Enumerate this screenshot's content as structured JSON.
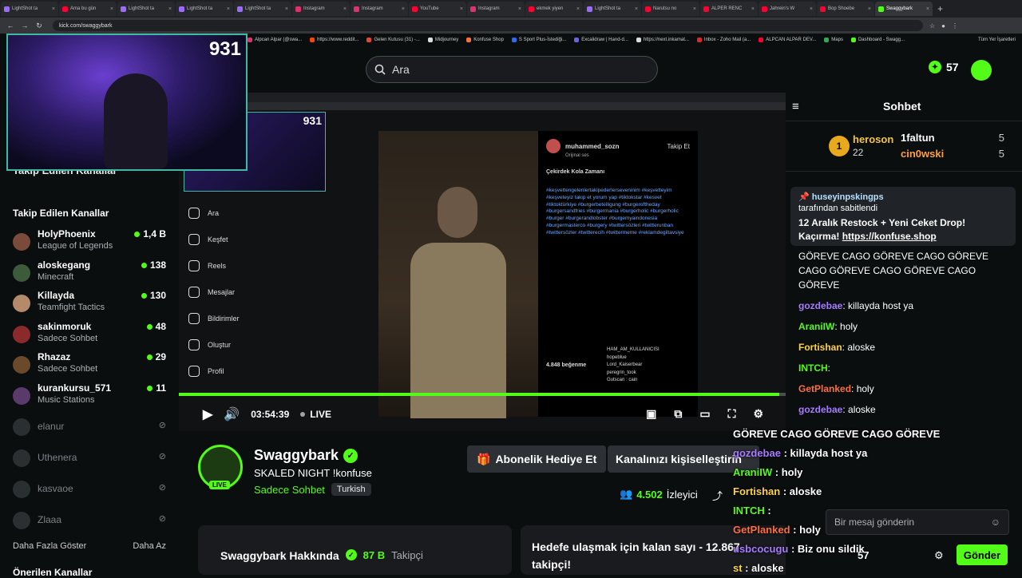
{
  "browser": {
    "tabs": [
      {
        "label": "LightShot ta",
        "color": "#9b6bff"
      },
      {
        "label": "Ama bu gün",
        "color": "#ff0033"
      },
      {
        "label": "LightShot ta",
        "color": "#9b6bff"
      },
      {
        "label": "LightShot ta",
        "color": "#9b6bff"
      },
      {
        "label": "LightShot ta",
        "color": "#9b6bff"
      },
      {
        "label": "Instagram",
        "color": "#e1306c"
      },
      {
        "label": "Instagram",
        "color": "#e1306c"
      },
      {
        "label": "YouTube",
        "color": "#ff0033"
      },
      {
        "label": "Instagram",
        "color": "#e1306c"
      },
      {
        "label": "ekmek yiyen",
        "color": "#ff0033"
      },
      {
        "label": "LightShot ta",
        "color": "#9b6bff"
      },
      {
        "label": "Narutsu no",
        "color": "#ff0033"
      },
      {
        "label": "ALPER RENC",
        "color": "#ff0033"
      },
      {
        "label": "Jahrein's W",
        "color": "#ff0033"
      },
      {
        "label": "Bop Shoebe",
        "color": "#ff0033"
      },
      {
        "label": "Swaggybark",
        "color": "#53fc18",
        "active": true
      }
    ],
    "url": "kick.com/swaggybark",
    "bookmarks": [
      {
        "label": "Alpcan Alpar (@swa...",
        "color": "#e1306c"
      },
      {
        "label": "https://www.reddit...",
        "color": "#ff4500"
      },
      {
        "label": "Gelen Kutusu (31) -...",
        "color": "#ea4335"
      },
      {
        "label": "Midjourney",
        "color": "#dddddd"
      },
      {
        "label": "Konfuse Shop",
        "color": "#ff6d3a"
      },
      {
        "label": "S Sport Plus-İstediği...",
        "color": "#2a6df4"
      },
      {
        "label": "Excalidraw | Hand-d...",
        "color": "#6965db"
      },
      {
        "label": "https://next.inkamat...",
        "color": "#dddddd"
      },
      {
        "label": "Inbox - Zoho Mail (a...",
        "color": "#e42527"
      },
      {
        "label": "ALPCAN ALPAR DEV...",
        "color": "#ff0033"
      },
      {
        "label": "Maps",
        "color": "#34a853"
      },
      {
        "label": "Dashboard - Swagg...",
        "color": "#53fc18"
      }
    ],
    "bookmarks_all": "Tüm Yer İşaretleri"
  },
  "header": {
    "search_placeholder": "Ara",
    "kicks_count": "57"
  },
  "webcam": {
    "viewer_count": "931"
  },
  "sidebar": {
    "ghost_title": "Takip Edilen Kanallar",
    "title": "Takip Edilen Kanallar",
    "channels": [
      {
        "name": "HolyPhoenix",
        "category": "League of Legends",
        "viewers": "1,4 B",
        "avatar": "#7a4a3a"
      },
      {
        "name": "aloskegang",
        "category": "Minecraft",
        "viewers": "138",
        "avatar": "#3d5a3a"
      },
      {
        "name": "Killayda",
        "category": "Teamfight Tactics",
        "viewers": "130",
        "avatar": "#b38a6a"
      },
      {
        "name": "sakinmoruk",
        "category": "Sadece Sohbet",
        "viewers": "48",
        "avatar": "#8a2a2a"
      },
      {
        "name": "Rhazaz",
        "category": "Sadece Sohbet",
        "viewers": "29",
        "avatar": "#6a4a2a"
      },
      {
        "name": "kurankursu_571",
        "category": "Music Stations",
        "viewers": "11",
        "avatar": "#5a3a6a"
      }
    ],
    "offline": [
      "elanur",
      "Uthenera",
      "kasvaoe",
      "Zlaaa"
    ],
    "show_more": "Daha Fazla Göster",
    "show_less": "Daha Az",
    "recommended": "Önerilen Kanallar"
  },
  "player": {
    "time": "03:54:39",
    "live": "LIVE",
    "progress": 0.99,
    "nested_count": "931",
    "ig_menu": [
      "Ara",
      "Keşfet",
      "Reels",
      "Mesajlar",
      "Bildirimler",
      "Oluştur",
      "Profil"
    ],
    "ig_user": "muhammed_sozn",
    "ig_sub": "Orijinal ses",
    "ig_caption": "Çekirdek Kola Zamanı",
    "ig_tags": "#keşvettengelenlertakipederlerseveninim #keşvetteyim #keşveteyiz takip et yorum yap #tiktokstar #kesvet #tiktoktürkiye #burgerbeteiligung #burgeroftheday #burgersandfries #burgermania #burgerholic #burgerholic #burger #burgerandlobster #burgemyaindonesia #burgermasterco #burgery #twittersözleri #twitterunban #twittersözler #twitterecih #twittermeme #reklamdegiltavsiye",
    "ig_likes": "4.848 beğenme",
    "ig_follow": "Takip Et",
    "overlay_lines": [
      "HAM_AM_KULLANICISI",
      "hopeblue",
      "Lord_Kaiserbear",
      "peregrin_took",
      "Gutscan : cain"
    ]
  },
  "channel": {
    "name": "Swaggybark",
    "title": "SKALED NIGHT !konfuse",
    "category": "Sadece Sohbet",
    "tag": "Turkish",
    "live_badge": "LIVE",
    "gift_label": "Abonelik Hediye Et",
    "customize_label": "Kanalınızı kişiselleştirin",
    "viewers": "4.502",
    "viewers_label": "İzleyici",
    "about_label": "Swaggybark Hakkında",
    "followers": "87 B",
    "followers_label": "Takipçi",
    "goal_text": "Hedefe ulaşmak için kalan sayı - 12.867 takipçi!"
  },
  "chat": {
    "title": "Sohbet",
    "leader": {
      "name": "heroson",
      "count": "22",
      "rank": "1"
    },
    "leaders": [
      {
        "name": "1faltun",
        "value": "5"
      },
      {
        "name": "cin0wski",
        "value": "5"
      }
    ],
    "pinned": {
      "by": "huseyinpskingps",
      "sub": "tarafından sabitlendi",
      "text": "12 Aralık Restock + Yeni Ceket Drop! Kaçırma!",
      "link": "https://konfuse.shop"
    },
    "spam": "GÖREVE CAGO GÖREVE CAGO GÖREVE CAGO GÖREVE CAGO GÖREVE CAGO GÖREVE",
    "messages": [
      {
        "user": "gozdebae",
        "text": "killayda host ya",
        "color": "#a77bff"
      },
      {
        "user": "AraniIW",
        "text": "holy",
        "color": "#53fc18"
      },
      {
        "user": "Fortishan",
        "text": "aloske",
        "color": "#ffd23f"
      },
      {
        "user": "INTCH",
        "text": "",
        "color": "#53fc18"
      },
      {
        "user": "GetPlanked",
        "text": "holy",
        "color": "#ff6d3a"
      },
      {
        "user": "gozdebae",
        "text": "aloske",
        "color": "#a77bff"
      }
    ],
    "input_placeholder": "Bir mesaj gönderin",
    "kick_count": "57",
    "send_label": "Gönder"
  },
  "overlay_chat": {
    "spam": "GÖREVE CAGO GÖREVE CAGO GÖREVE",
    "lines": [
      {
        "user": "gozdebae",
        "text": "killayda host ya"
      },
      {
        "user": "AraniIW",
        "text": "holy"
      },
      {
        "user": "Fortishan",
        "text": "aloske"
      },
      {
        "user": "INTCH",
        "text": ""
      },
      {
        "user": "GetPlanked",
        "text": "holy"
      },
      {
        "user": "usbcocugu",
        "text": "Biz onu sildik"
      },
      {
        "user": "st",
        "text": "aloske"
      }
    ]
  }
}
